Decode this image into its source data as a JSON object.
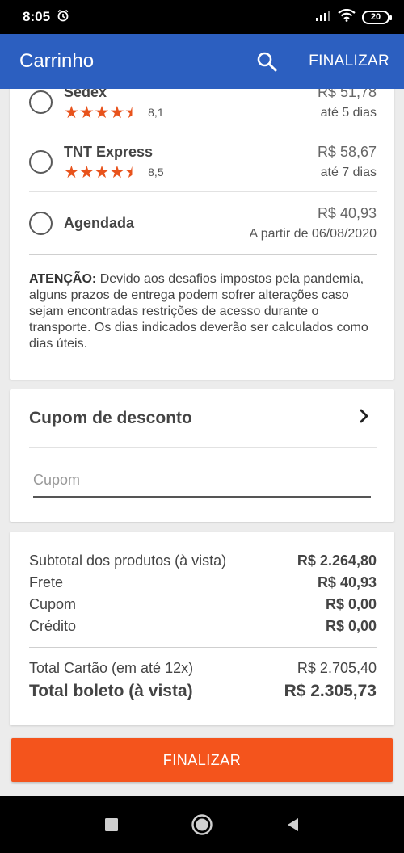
{
  "status_bar": {
    "time": "8:05",
    "battery": "20"
  },
  "app_bar": {
    "title": "Carrinho",
    "action": "FINALIZAR"
  },
  "shipping": [
    {
      "name": "Sedex",
      "rating": "8,1",
      "stars": 4.5,
      "price": "R$ 51,78",
      "eta": "até 5 dias"
    },
    {
      "name": "TNT Express",
      "rating": "8,5",
      "stars": 4.5,
      "price": "R$ 58,67",
      "eta": "até 7 dias"
    },
    {
      "name": "Agendada",
      "price": "R$ 40,93",
      "eta": "A partir de 06/08/2020"
    }
  ],
  "notice": {
    "label": "ATENÇÃO:",
    "text": "Devido aos desafios impostos pela pandemia, alguns prazos de entrega podem sofrer alterações caso sejam encontradas restrições de acesso durante o transporte. Os dias indicados deverão ser calculados como dias úteis."
  },
  "coupon": {
    "title": "Cupom de desconto",
    "placeholder": "Cupom",
    "value": ""
  },
  "summary": {
    "subtotal_label": "Subtotal dos produtos (à vista)",
    "subtotal_value": "R$ 2.264,80",
    "frete_label": "Frete",
    "frete_value": "R$ 40,93",
    "cupom_label": "Cupom",
    "cupom_value": "R$ 0,00",
    "credito_label": "Crédito",
    "credito_value": "R$ 0,00",
    "total_cartao_label": "Total Cartão (em até 12x)",
    "total_cartao_value": "R$ 2.705,40",
    "total_boleto_label": "Total boleto (à vista)",
    "total_boleto_value": "R$ 2.305,73"
  },
  "button": {
    "finalizar": "FINALIZAR"
  },
  "colors": {
    "app_bar": "#2c5fc0",
    "accent": "#f4541c",
    "stars": "#e8531c"
  }
}
